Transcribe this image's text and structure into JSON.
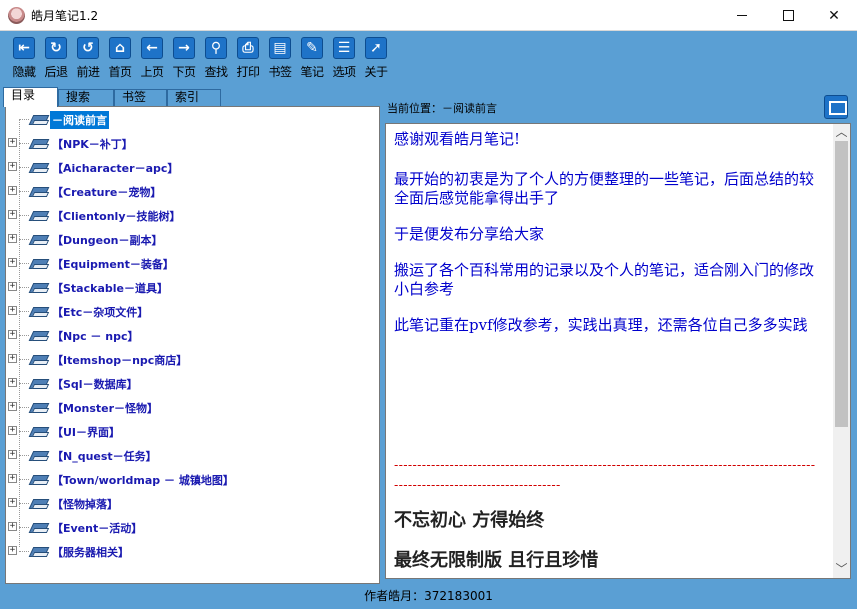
{
  "window": {
    "title": "皓月笔记1.2"
  },
  "toolbar": {
    "buttons": [
      {
        "label": "隐藏",
        "icon": "hide-icon",
        "glyph": "⇤"
      },
      {
        "label": "后退",
        "icon": "back-icon",
        "glyph": "↻"
      },
      {
        "label": "前进",
        "icon": "forward-icon",
        "glyph": "↺"
      },
      {
        "label": "首页",
        "icon": "home-icon",
        "glyph": "⌂"
      },
      {
        "label": "上页",
        "icon": "prev-page-icon",
        "glyph": "←"
      },
      {
        "label": "下页",
        "icon": "next-page-icon",
        "glyph": "→"
      },
      {
        "label": "查找",
        "icon": "search-icon",
        "glyph": "⚲"
      },
      {
        "label": "打印",
        "icon": "print-icon",
        "glyph": "⎙"
      },
      {
        "label": "书签",
        "icon": "bookmark-icon",
        "glyph": "▤"
      },
      {
        "label": "笔记",
        "icon": "note-icon",
        "glyph": "✎"
      },
      {
        "label": "选项",
        "icon": "options-icon",
        "glyph": "☰"
      },
      {
        "label": "关于",
        "icon": "about-icon",
        "glyph": "➚"
      }
    ]
  },
  "tabs": [
    "目录",
    "搜索",
    "书签",
    "索引"
  ],
  "tree": {
    "items": [
      {
        "label": "－阅读前言",
        "selected": true,
        "expandable": false
      },
      {
        "label": "【NPK－补丁】",
        "expandable": true
      },
      {
        "label": "【Aicharacter－apc】",
        "expandable": true
      },
      {
        "label": "【Creature－宠物】",
        "expandable": true
      },
      {
        "label": "【Clientonly－技能树】",
        "expandable": true
      },
      {
        "label": "【Dungeon－副本】",
        "expandable": true
      },
      {
        "label": "【Equipment－装备】",
        "expandable": true
      },
      {
        "label": "【Stackable－道具】",
        "expandable": true
      },
      {
        "label": "【Etc－杂项文件】",
        "expandable": true
      },
      {
        "label": "【Npc － npc】",
        "expandable": true
      },
      {
        "label": "【Itemshop－npc商店】",
        "expandable": true
      },
      {
        "label": "【Sql－数据库】",
        "expandable": true
      },
      {
        "label": "【Monster－怪物】",
        "expandable": true
      },
      {
        "label": "【UI－界面】",
        "expandable": true
      },
      {
        "label": "【N_quest－任务】",
        "expandable": true
      },
      {
        "label": "【Town/worldmap － 城镇地图】",
        "expandable": true
      },
      {
        "label": "【怪物掉落】",
        "expandable": true
      },
      {
        "label": "【Event－活动】",
        "expandable": true
      },
      {
        "label": "【服务器相关】",
        "expandable": true
      }
    ]
  },
  "location": {
    "label": "当前位置：－阅读前言"
  },
  "content": {
    "paragraphs": [
      "感谢观看皓月笔记!",
      "最开始的初衷是为了个人的方便整理的一些笔记，后面总结的较全面后感觉能拿得出手了",
      "于是便发布分享给大家",
      "搬运了各个百科常用的记录以及个人的笔记，适合刚入门的修改小白参考",
      "此笔记重在pvf修改参考，实践出真理，还需各位自己多多实践"
    ],
    "divider": "-------------------------------------------------------------------------------------------------------------------------------",
    "motto1": "不忘初心  方得始终",
    "motto2": "最终无限制版  且行且珍惜"
  },
  "status": {
    "text": "作者皓月：372183001"
  },
  "colors": {
    "accent": "#5a9fd4",
    "link_text": "#1a1ab0",
    "body_text": "#0000cc",
    "divider": "#d00000",
    "selection": "#0078d7"
  }
}
